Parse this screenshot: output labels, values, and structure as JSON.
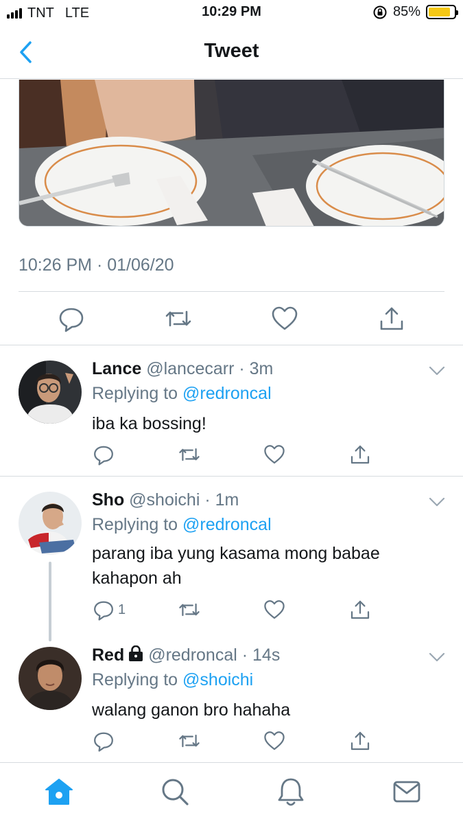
{
  "status_bar": {
    "carrier": "TNT",
    "network": "LTE",
    "time": "10:29 PM",
    "battery_percent": "85%",
    "battery_level": 0.85,
    "battery_color": "#f5c816"
  },
  "nav": {
    "title": "Tweet",
    "back_icon": "chevron-left-icon"
  },
  "tweet": {
    "timestamp": "10:26 PM · 01/06/20",
    "actions": [
      "reply-icon",
      "retweet-icon",
      "like-icon",
      "share-icon"
    ]
  },
  "replies": [
    {
      "name": "Lance",
      "handle": "@lancecarr",
      "time": "3m",
      "replying_label": "Replying to",
      "replying_to": "@redroncal",
      "text": "iba ka bossing!",
      "reply_count": ""
    },
    {
      "name": "Sho",
      "handle": "@shoichi",
      "time": "1m",
      "replying_label": "Replying to",
      "replying_to": "@redroncal",
      "text": "parang iba yung kasama mong babae kahapon ah",
      "reply_count": "1"
    },
    {
      "name": "Red",
      "handle": "@redroncal",
      "time": "14s",
      "replying_label": "Replying to",
      "replying_to": "@shoichi",
      "text": "walang ganon bro hahaha",
      "reply_count": "",
      "locked": true
    }
  ],
  "tab_bar": {
    "items": [
      "home-icon",
      "search-icon",
      "notifications-icon",
      "messages-icon"
    ],
    "active": "home-icon"
  },
  "colors": {
    "accent": "#1da1f2",
    "secondary_text": "#657786",
    "divider": "#d6dbdf"
  }
}
